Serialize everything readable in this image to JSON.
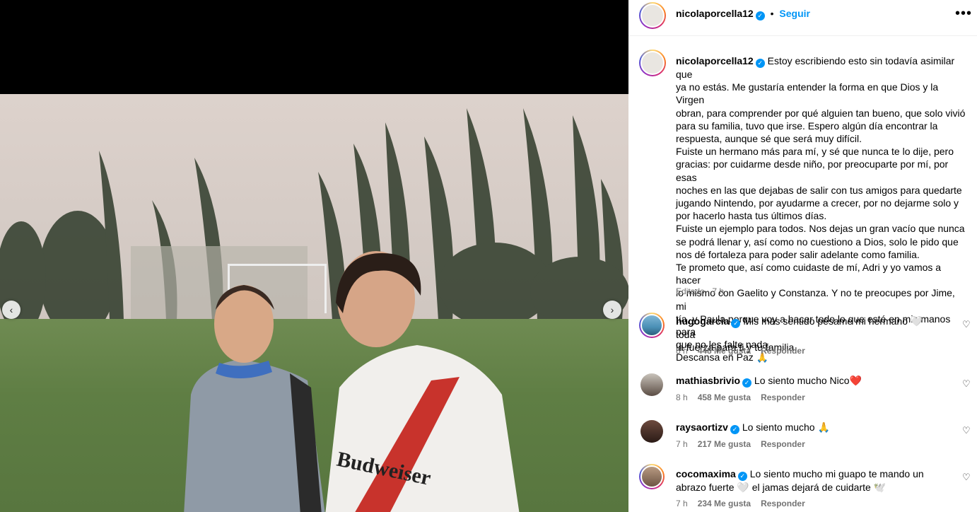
{
  "post": {
    "author": "nicolaporcella12",
    "follow_label": "Seguir",
    "separator": "•",
    "more_icon": "more-horizontal-icon"
  },
  "caption": {
    "author": "nicolaporcella12",
    "lines": [
      "Estoy escribiendo esto sin todavía asimilar que",
      "ya no estás. Me gustaría entender la forma en que Dios y la Virgen",
      "obran, para comprender por qué alguien tan bueno, que solo vivió",
      "para su familia, tuvo que irse. Espero algún día encontrar la",
      "respuesta, aunque sé que será muy difícil.",
      "Fuiste un hermano más para mí, y sé que nunca te lo dije, pero",
      "gracias: por cuidarme desde niño, por preocuparte por mí, por esas",
      "noches en las que dejabas de salir con tus amigos para quedarte",
      "jugando Nintendo, por ayudarme a crecer, por no dejarme solo y",
      "por hacerlo hasta tus últimos días.",
      "Fuiste un ejemplo para todos. Nos dejas un gran vacío que nunca",
      "se podrá llenar y, así como no cuestiono a Dios, solo le pido que",
      "nos dé fortaleza para poder salir adelante como familia.",
      "Te prometo que, así como cuidaste de mí, Adri y yo vamos a hacer",
      "lo mismo con Gaelito y Constanza. Y no te preocupes por Jime, mi",
      "tía, y Paula porque voy a hacer todo lo que esté en mis manos para",
      "que no les falte nada.",
      "Descansa en Paz 🙏"
    ],
    "meta": "Editado · 7 h"
  },
  "comments": [
    {
      "user": "hugogarcia",
      "line1": "Mis más sentido pésame mi hermano 🤍  toda",
      "line2": "la fuerza para ti y tu familia.",
      "time": "8 h",
      "likes": "448 Me gusta",
      "reply": "Responder"
    },
    {
      "user": "mathiasbrivio",
      "line1": "Lo siento mucho Nico❤️",
      "line2": "",
      "time": "8 h",
      "likes": "458 Me gusta",
      "reply": "Responder"
    },
    {
      "user": "raysaortizv",
      "line1": "Lo siento mucho  🙏",
      "line2": "",
      "time": "7 h",
      "likes": "217 Me gusta",
      "reply": "Responder"
    },
    {
      "user": "cocomaxima",
      "line1": "Lo siento mucho mi guapo te mando un",
      "line2": "abrazo fuerte 🤍  el jamas dejará de cuidarte 🕊️",
      "time": "7 h",
      "likes": "234 Me gusta",
      "reply": "Responder"
    }
  ],
  "media": {
    "prev_icon": "‹",
    "next_icon": "›",
    "jersey_text": "Budweiser"
  },
  "colors": {
    "accent": "#0095f6",
    "muted": "#737373",
    "verified": "#0095f6"
  }
}
